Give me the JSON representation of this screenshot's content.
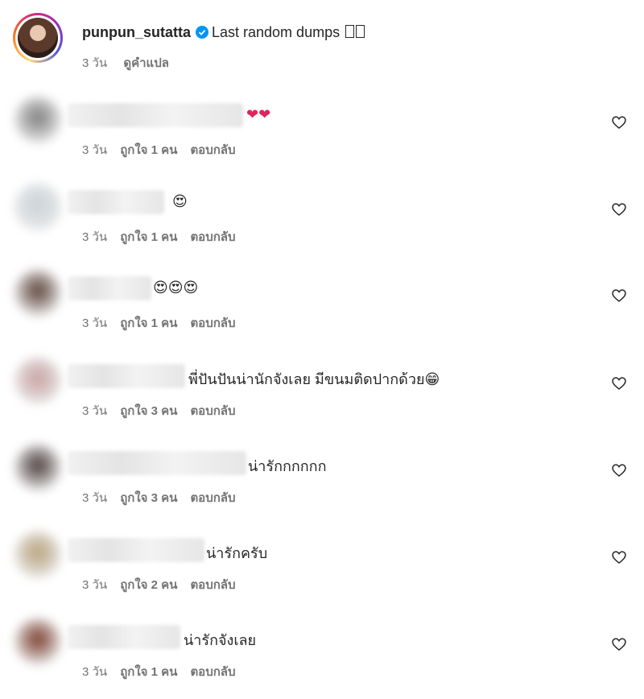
{
  "caption": {
    "username": "punpun_sutatta",
    "text": "Last random dumps",
    "time": "3 วัน",
    "translate": "ดูคำแปล"
  },
  "comments": [
    {
      "text": "❤❤",
      "time": "3 วัน",
      "likes": "ถูกใจ 1 คน",
      "reply": "ตอบกลับ",
      "avatar_color": "#7c7c7c"
    },
    {
      "text": "😍",
      "time": "3 วัน",
      "likes": "ถูกใจ 1 คน",
      "reply": "ตอบกลับ",
      "avatar_color": "#c9d3d8"
    },
    {
      "text": "😍😍😍",
      "time": "3 วัน",
      "likes": "ถูกใจ 1 คน",
      "reply": "ตอบกลับ",
      "avatar_color": "#5a4036"
    },
    {
      "text": "พี่ปันปันน่านักจังเลย มีขนมติดปากด้วย😁",
      "time": "3 วัน",
      "likes": "ถูกใจ 3 คน",
      "reply": "ตอบกลับ",
      "avatar_color": "#c9a0a0"
    },
    {
      "text": "น่ารักกกกกก",
      "time": "3 วัน",
      "likes": "ถูกใจ 3 คน",
      "reply": "ตอบกลับ",
      "avatar_color": "#4a3a3a"
    },
    {
      "text": "น่ารักครับ",
      "time": "3 วัน",
      "likes": "ถูกใจ 2 คน",
      "reply": "ตอบกลับ",
      "avatar_color": "#b8a27a"
    },
    {
      "text": "น่ารักจังเลย",
      "time": "3 วัน",
      "likes": "ถูกใจ 1 คน",
      "reply": "ตอบกลับ",
      "avatar_color": "#7a3a2a"
    }
  ],
  "colors": {
    "heart_red": "#e0245e",
    "verified_blue": "#0095f6",
    "meta_gray": "#737373"
  }
}
